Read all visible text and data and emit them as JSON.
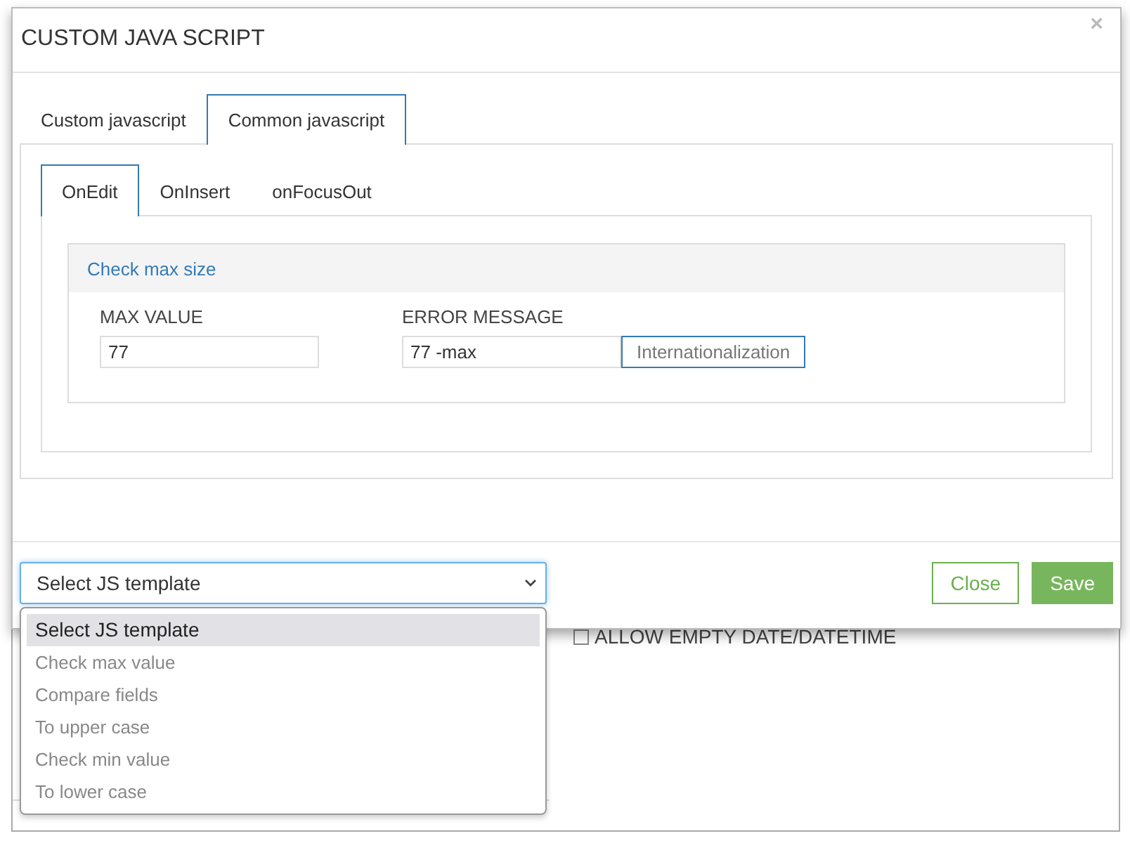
{
  "background": {
    "checkbox": {
      "label": "ALLOW EMPTY DATE/DATETIME",
      "checked": false
    }
  },
  "dialog": {
    "title": "CUSTOM JAVA SCRIPT",
    "close_label": "×",
    "tabs": [
      {
        "label": "Custom javascript",
        "selected": false
      },
      {
        "label": "Common javascript",
        "selected": true
      }
    ],
    "subtabs": [
      {
        "label": "OnEdit",
        "selected": true
      },
      {
        "label": "OnInsert",
        "selected": false
      },
      {
        "label": "onFocusOut",
        "selected": false
      }
    ],
    "panel": {
      "title": "Check max size",
      "fields": [
        {
          "label": "MAX VALUE",
          "value": "77"
        },
        {
          "label": "ERROR MESSAGE",
          "value": "77 -max",
          "button": "Internationalization"
        }
      ]
    },
    "template_select": {
      "value": "Select JS template",
      "expanded": true,
      "options": [
        {
          "label": "Select JS template",
          "selected": true
        },
        {
          "label": "Check max value",
          "selected": false
        },
        {
          "label": "Compare fields",
          "selected": false
        },
        {
          "label": "To upper case",
          "selected": false
        },
        {
          "label": "Check min value",
          "selected": false
        },
        {
          "label": "To lower case",
          "selected": false
        }
      ]
    },
    "buttons": [
      {
        "label": "Close",
        "kind": "outline"
      },
      {
        "label": "Save",
        "kind": "primary"
      }
    ]
  }
}
